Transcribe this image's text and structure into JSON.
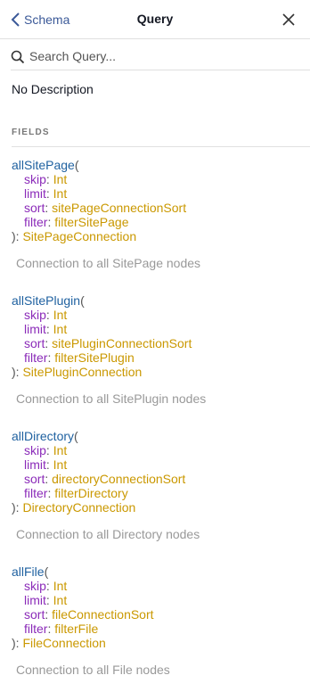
{
  "header": {
    "back_label": "Schema",
    "title": "Query",
    "back_icon": "chevron-left-icon",
    "close_icon": "close-icon"
  },
  "search": {
    "placeholder": "Search Query...",
    "value": "",
    "icon": "search-icon"
  },
  "description": "No Description",
  "fields_heading": "FIELDS",
  "colors": {
    "field_name": "#1f61a0",
    "arg_name": "#8b2bb9",
    "type": "#ca9800",
    "desc": "#999999",
    "link": "#3b5998"
  },
  "fields": [
    {
      "name": "allSitePage",
      "open": "(",
      "close": "): ",
      "args": [
        {
          "name": "skip",
          "sep": ": ",
          "type": "Int"
        },
        {
          "name": "limit",
          "sep": ": ",
          "type": "Int"
        },
        {
          "name": "sort",
          "sep": ": ",
          "type": "sitePageConnectionSort"
        },
        {
          "name": "filter",
          "sep": ": ",
          "type": "filterSitePage"
        }
      ],
      "return_type": "SitePageConnection",
      "description": "Connection to all SitePage nodes"
    },
    {
      "name": "allSitePlugin",
      "open": "(",
      "close": "): ",
      "args": [
        {
          "name": "skip",
          "sep": ": ",
          "type": "Int"
        },
        {
          "name": "limit",
          "sep": ": ",
          "type": "Int"
        },
        {
          "name": "sort",
          "sep": ": ",
          "type": "sitePluginConnectionSort"
        },
        {
          "name": "filter",
          "sep": ": ",
          "type": "filterSitePlugin"
        }
      ],
      "return_type": "SitePluginConnection",
      "description": "Connection to all SitePlugin nodes"
    },
    {
      "name": "allDirectory",
      "open": "(",
      "close": "): ",
      "args": [
        {
          "name": "skip",
          "sep": ": ",
          "type": "Int"
        },
        {
          "name": "limit",
          "sep": ": ",
          "type": "Int"
        },
        {
          "name": "sort",
          "sep": ": ",
          "type": "directoryConnectionSort"
        },
        {
          "name": "filter",
          "sep": ": ",
          "type": "filterDirectory"
        }
      ],
      "return_type": "DirectoryConnection",
      "description": "Connection to all Directory nodes"
    },
    {
      "name": "allFile",
      "open": "(",
      "close": "): ",
      "args": [
        {
          "name": "skip",
          "sep": ": ",
          "type": "Int"
        },
        {
          "name": "limit",
          "sep": ": ",
          "type": "Int"
        },
        {
          "name": "sort",
          "sep": ": ",
          "type": "fileConnectionSort"
        },
        {
          "name": "filter",
          "sep": ": ",
          "type": "filterFile"
        }
      ],
      "return_type": "FileConnection",
      "description": "Connection to all File nodes"
    }
  ]
}
